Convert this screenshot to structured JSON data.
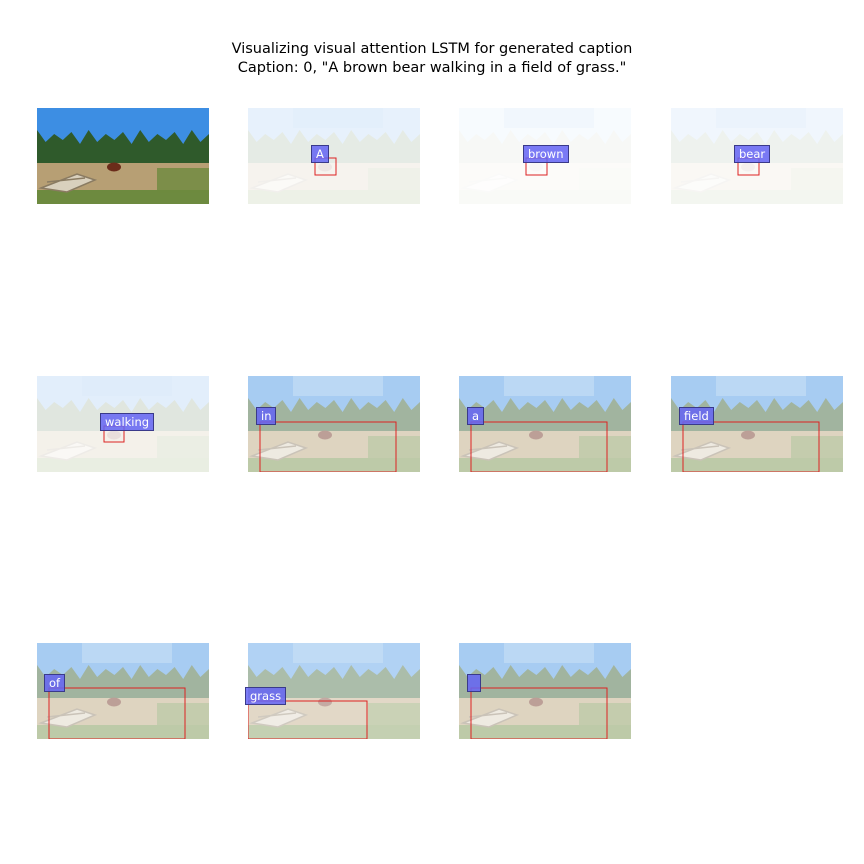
{
  "figure": {
    "title_line1": "Visualizing visual attention LSTM for generated caption",
    "title_line2": "Caption: 0, \"A brown bear walking in a field of grass.\""
  },
  "colors": {
    "sky": "#3d8ee3",
    "trees": "#2f5a2b",
    "ground": "#b79f74",
    "grass": "#6d8a3f",
    "bear": "#6b2c1a",
    "attention_box": "#dd2222",
    "label_fill": "#6464f5"
  },
  "chart_data": {
    "type": "image-grid",
    "caption": "A brown bear walking in a field of grass.",
    "panels": [
      {
        "word": null,
        "kind": "original"
      },
      {
        "word": "A",
        "attention": 0.1,
        "fade": 0.88
      },
      {
        "word": "brown",
        "attention": 0.08,
        "fade": 0.96
      },
      {
        "word": "bear",
        "attention": 0.08,
        "fade": 0.92
      },
      {
        "word": "walking",
        "attention": 0.12,
        "fade": 0.85
      },
      {
        "word": "in",
        "attention": 0.8,
        "fade": 0.55
      },
      {
        "word": "a",
        "attention": 0.8,
        "fade": 0.55
      },
      {
        "word": "field",
        "attention": 0.8,
        "fade": 0.55
      },
      {
        "word": "of",
        "attention": 0.8,
        "fade": 0.55
      },
      {
        "word": "grass",
        "attention": 0.7,
        "fade": 0.6
      },
      {
        "word": "",
        "attention": 0.8,
        "fade": 0.55
      }
    ]
  }
}
